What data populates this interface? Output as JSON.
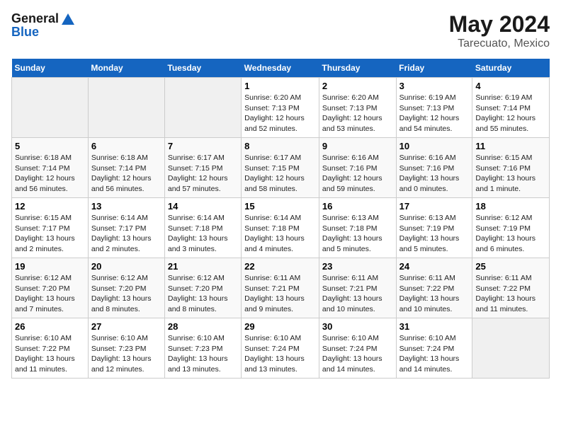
{
  "logo": {
    "general": "General",
    "blue": "Blue"
  },
  "title": {
    "month_year": "May 2024",
    "location": "Tarecuato, Mexico"
  },
  "headers": [
    "Sunday",
    "Monday",
    "Tuesday",
    "Wednesday",
    "Thursday",
    "Friday",
    "Saturday"
  ],
  "weeks": [
    [
      {
        "day": "",
        "info": ""
      },
      {
        "day": "",
        "info": ""
      },
      {
        "day": "",
        "info": ""
      },
      {
        "day": "1",
        "info": "Sunrise: 6:20 AM\nSunset: 7:13 PM\nDaylight: 12 hours\nand 52 minutes."
      },
      {
        "day": "2",
        "info": "Sunrise: 6:20 AM\nSunset: 7:13 PM\nDaylight: 12 hours\nand 53 minutes."
      },
      {
        "day": "3",
        "info": "Sunrise: 6:19 AM\nSunset: 7:13 PM\nDaylight: 12 hours\nand 54 minutes."
      },
      {
        "day": "4",
        "info": "Sunrise: 6:19 AM\nSunset: 7:14 PM\nDaylight: 12 hours\nand 55 minutes."
      }
    ],
    [
      {
        "day": "5",
        "info": "Sunrise: 6:18 AM\nSunset: 7:14 PM\nDaylight: 12 hours\nand 56 minutes."
      },
      {
        "day": "6",
        "info": "Sunrise: 6:18 AM\nSunset: 7:14 PM\nDaylight: 12 hours\nand 56 minutes."
      },
      {
        "day": "7",
        "info": "Sunrise: 6:17 AM\nSunset: 7:15 PM\nDaylight: 12 hours\nand 57 minutes."
      },
      {
        "day": "8",
        "info": "Sunrise: 6:17 AM\nSunset: 7:15 PM\nDaylight: 12 hours\nand 58 minutes."
      },
      {
        "day": "9",
        "info": "Sunrise: 6:16 AM\nSunset: 7:16 PM\nDaylight: 12 hours\nand 59 minutes."
      },
      {
        "day": "10",
        "info": "Sunrise: 6:16 AM\nSunset: 7:16 PM\nDaylight: 13 hours\nand 0 minutes."
      },
      {
        "day": "11",
        "info": "Sunrise: 6:15 AM\nSunset: 7:16 PM\nDaylight: 13 hours\nand 1 minute."
      }
    ],
    [
      {
        "day": "12",
        "info": "Sunrise: 6:15 AM\nSunset: 7:17 PM\nDaylight: 13 hours\nand 2 minutes."
      },
      {
        "day": "13",
        "info": "Sunrise: 6:14 AM\nSunset: 7:17 PM\nDaylight: 13 hours\nand 2 minutes."
      },
      {
        "day": "14",
        "info": "Sunrise: 6:14 AM\nSunset: 7:18 PM\nDaylight: 13 hours\nand 3 minutes."
      },
      {
        "day": "15",
        "info": "Sunrise: 6:14 AM\nSunset: 7:18 PM\nDaylight: 13 hours\nand 4 minutes."
      },
      {
        "day": "16",
        "info": "Sunrise: 6:13 AM\nSunset: 7:18 PM\nDaylight: 13 hours\nand 5 minutes."
      },
      {
        "day": "17",
        "info": "Sunrise: 6:13 AM\nSunset: 7:19 PM\nDaylight: 13 hours\nand 5 minutes."
      },
      {
        "day": "18",
        "info": "Sunrise: 6:12 AM\nSunset: 7:19 PM\nDaylight: 13 hours\nand 6 minutes."
      }
    ],
    [
      {
        "day": "19",
        "info": "Sunrise: 6:12 AM\nSunset: 7:20 PM\nDaylight: 13 hours\nand 7 minutes."
      },
      {
        "day": "20",
        "info": "Sunrise: 6:12 AM\nSunset: 7:20 PM\nDaylight: 13 hours\nand 8 minutes."
      },
      {
        "day": "21",
        "info": "Sunrise: 6:12 AM\nSunset: 7:20 PM\nDaylight: 13 hours\nand 8 minutes."
      },
      {
        "day": "22",
        "info": "Sunrise: 6:11 AM\nSunset: 7:21 PM\nDaylight: 13 hours\nand 9 minutes."
      },
      {
        "day": "23",
        "info": "Sunrise: 6:11 AM\nSunset: 7:21 PM\nDaylight: 13 hours\nand 10 minutes."
      },
      {
        "day": "24",
        "info": "Sunrise: 6:11 AM\nSunset: 7:22 PM\nDaylight: 13 hours\nand 10 minutes."
      },
      {
        "day": "25",
        "info": "Sunrise: 6:11 AM\nSunset: 7:22 PM\nDaylight: 13 hours\nand 11 minutes."
      }
    ],
    [
      {
        "day": "26",
        "info": "Sunrise: 6:10 AM\nSunset: 7:22 PM\nDaylight: 13 hours\nand 11 minutes."
      },
      {
        "day": "27",
        "info": "Sunrise: 6:10 AM\nSunset: 7:23 PM\nDaylight: 13 hours\nand 12 minutes."
      },
      {
        "day": "28",
        "info": "Sunrise: 6:10 AM\nSunset: 7:23 PM\nDaylight: 13 hours\nand 13 minutes."
      },
      {
        "day": "29",
        "info": "Sunrise: 6:10 AM\nSunset: 7:24 PM\nDaylight: 13 hours\nand 13 minutes."
      },
      {
        "day": "30",
        "info": "Sunrise: 6:10 AM\nSunset: 7:24 PM\nDaylight: 13 hours\nand 14 minutes."
      },
      {
        "day": "31",
        "info": "Sunrise: 6:10 AM\nSunset: 7:24 PM\nDaylight: 13 hours\nand 14 minutes."
      },
      {
        "day": "",
        "info": ""
      }
    ]
  ]
}
